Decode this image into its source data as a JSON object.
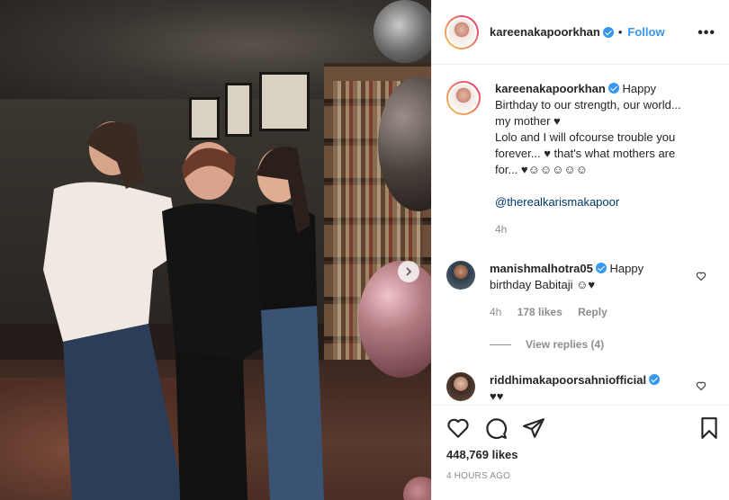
{
  "post": {
    "username": "kareenakapoorkhan",
    "follow_label": "Follow",
    "more_label": "•••",
    "caption_lines": [
      "Happy",
      "Birthday to our strength, our world...",
      "my mother ♥",
      "Lolo and I will ofcourse trouble you",
      "forever... ♥ that's what mothers are",
      "for... ♥☺☺☺☺☺"
    ],
    "mention": "@therealkarismakapoor",
    "caption_time": "4h"
  },
  "comments": [
    {
      "username": "manishmalhotra05",
      "text_first": "Happy",
      "text_rest": "birthday Babitaji ☺♥",
      "time": "4h",
      "likes": "178 likes",
      "reply": "Reply",
      "view_replies": "View replies (4)"
    },
    {
      "username": "riddhimakapoorsahniofficial",
      "text": "♥♥"
    }
  ],
  "footer": {
    "likes": "448,769 likes",
    "time_ago": "4 HOURS AGO"
  },
  "colors": {
    "accent": "#3897f0",
    "text": "#262626",
    "muted": "#8e8e8e",
    "mention": "#00376b"
  },
  "icons": [
    "heart-icon",
    "comment-icon",
    "share-icon",
    "bookmark-icon",
    "chevron-right-icon",
    "verified-icon",
    "more-icon"
  ]
}
